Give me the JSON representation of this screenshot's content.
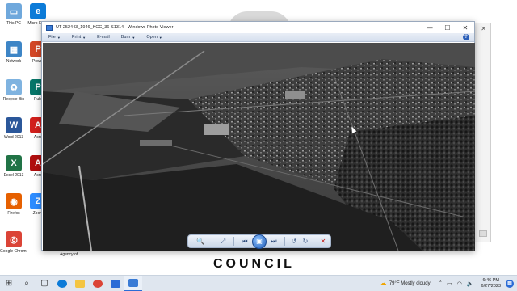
{
  "desktop": {
    "icons": [
      {
        "label": "This PC",
        "icon": "computer-icon",
        "color": "#6fa8dc",
        "glyph": "▭"
      },
      {
        "label": "Network",
        "icon": "network-icon",
        "color": "#3d85c6",
        "glyph": "▦"
      },
      {
        "label": "Recycle Bin",
        "icon": "recycle-bin-icon",
        "color": "#7fb3e0",
        "glyph": "♻"
      },
      {
        "label": "Word 2013",
        "icon": "word-icon",
        "color": "#2b579a",
        "glyph": "W"
      },
      {
        "label": "Excel 2013",
        "icon": "excel-icon",
        "color": "#217346",
        "glyph": "X"
      },
      {
        "label": "Firefox",
        "icon": "firefox-icon",
        "color": "#e66000",
        "glyph": "◉"
      },
      {
        "label": "Google Chrome",
        "icon": "chrome-icon",
        "color": "#db4437",
        "glyph": "◎"
      }
    ],
    "second_column": [
      {
        "label": "Micro Edge",
        "icon": "edge-icon",
        "color": "#0c7bd8",
        "glyph": "e"
      },
      {
        "label": "Power",
        "icon": "powerpoint-icon",
        "color": "#d24726",
        "glyph": "P"
      },
      {
        "label": "Publ",
        "icon": "publisher-icon",
        "color": "#077568",
        "glyph": "P"
      },
      {
        "label": "Acro",
        "icon": "acrobat-icon",
        "color": "#d1201c",
        "glyph": "A"
      },
      {
        "label": "Acro",
        "icon": "acrobat-icon",
        "color": "#b00f0f",
        "glyph": "A"
      },
      {
        "label": "Zoom",
        "icon": "zoom-icon",
        "color": "#2d8cff",
        "glyph": "Z"
      }
    ],
    "agency_label": "Agency of ...",
    "council_text": "COUNCIL"
  },
  "viewer": {
    "title": "UT-252443_1946_KCC_36-S1314 - Windows Photo Viewer",
    "menu": [
      {
        "label": "File"
      },
      {
        "label": "Print"
      },
      {
        "label": "E-mail"
      },
      {
        "label": "Burn"
      },
      {
        "label": "Open"
      }
    ],
    "help_label": "?",
    "window_buttons": {
      "minimize": "—",
      "maximize": "☐",
      "close": "✕"
    },
    "controls": {
      "zoom": "🔍",
      "fit": "⤢",
      "previous": "⏮",
      "slideshow": "▣",
      "next": "⏭",
      "rotate_ccw": "↺",
      "rotate_cw": "↻",
      "delete": "✕"
    }
  },
  "taskbar": {
    "weather": "79°F  Mostly cloudy",
    "time": "6:46 PM",
    "date": "6/27/2023"
  }
}
